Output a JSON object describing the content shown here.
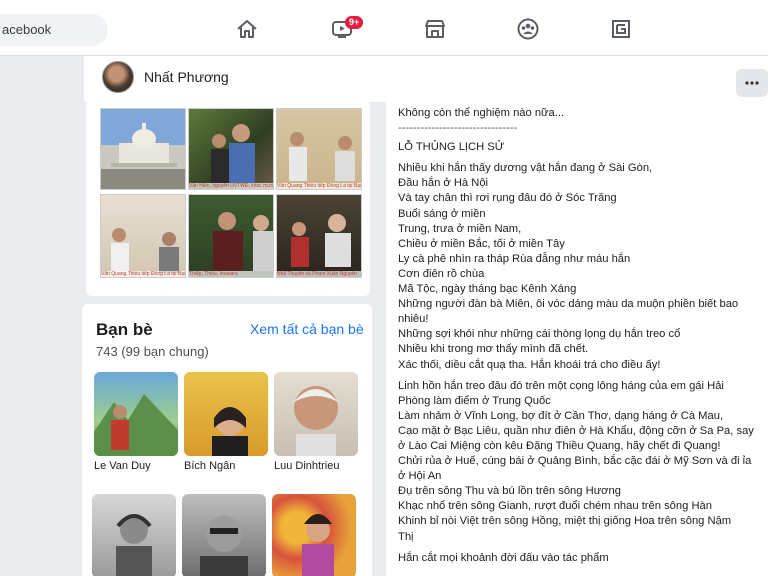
{
  "topbar": {
    "search_text": "acebook",
    "notification_badge": "9+",
    "icons": [
      "home-icon",
      "video-icon",
      "marketplace-icon",
      "groups-icon",
      "gaming-icon"
    ]
  },
  "profile": {
    "name": "Nhất Phương"
  },
  "photos": {
    "captions": [
      "",
      "Văn Hiến, nguyên UVTWĐ, khóc mười một...",
      "Văn Quang Thiều tiếp Đồng La tại Bạc Vi",
      "Văn Quang Thiều tiếp Đồng La tại Bạc V",
      "Thiệp, Thiều, Inrasara",
      "Nhã Thuyên và Phạm Xuân Nguyên"
    ]
  },
  "friends": {
    "title": "Bạn bè",
    "see_all": "Xem tất cả bạn bè",
    "count": "743 (99 bạn chung)",
    "items": [
      {
        "name": "Le Van Duy"
      },
      {
        "name": "Bích Ngân"
      },
      {
        "name": "Luu Dinhtrieu"
      },
      {
        "name": ""
      },
      {
        "name": ""
      },
      {
        "name": ""
      }
    ]
  },
  "post": {
    "lines": [
      "Không còn thể nghiệm nào nữa...",
      "--------------------------------",
      "LỖ THỦNG LỊCH SỬ",
      "",
      "Nhiều khi hắn thấy dương vật hắn đang ở Sài Gòn,",
      "Đầu hắn ở Hà Nội",
      "Và tay chân thì rơi rụng đâu đó ở Sóc Trăng",
      "Buổi sáng ở miền",
      "Trung, trưa ở miền Nam,",
      "Chiều ở miền Bắc, tối ở miền Tây",
      "Ly cà phê nhìn ra tháp Rùa đẫng như máu hắn",
      "Cơn điên rồ chùa",
      "Mã Tộc, ngày tháng bạc Kênh Xáng",
      "Những người đàn bà Miên, ôi vóc dáng màu da muộn phiền biết bao",
      "nhiêu!",
      "Những sợi khói như những cái thòng lọng dụ hắn treo cổ",
      "Nhiều khi trong mơ thấy mình đã chết.",
      "Xác thối, diều cắt quạ tha. Hắn khoái trá cho điều ấy!",
      "",
      "Linh hồn hắn treo đâu đó trên một cọng lông háng của em gái Hải",
      "Phòng làm điểm ở Trung Quốc",
      "Làm nhảm ở Vĩnh Long, bợ đít ở Cần Thơ, dạng háng ở Cà Mau,",
      "Cạo mặt ở Bạc Liêu, quần như điên ở Hà Khẩu, động cỡn ở Sa Pa, say",
      "ở Lào Cai Miệng còn kêu Đặng Thiều Quang, hãy chết đi Quang!",
      "Chửi rủa ở Huế, cúng bái ở Quảng Bình, bắc cặc đái ở Mỹ Sơn và đi ỉa",
      "ở Hội An",
      "Đụ trên sông Thu và bú lồn trên sông Hương",
      "Khạc nhổ trên sông Gianh, rượt đuổi chém nhau trên sông Hàn",
      "Khinh bỉ nòi Việt trên sông Hồng, miệt thị giống Hoa trên sông Nậm",
      "Thị",
      "",
      "Hắn cắt mọi khoảnh đời đấu vào tác phẩm"
    ]
  }
}
